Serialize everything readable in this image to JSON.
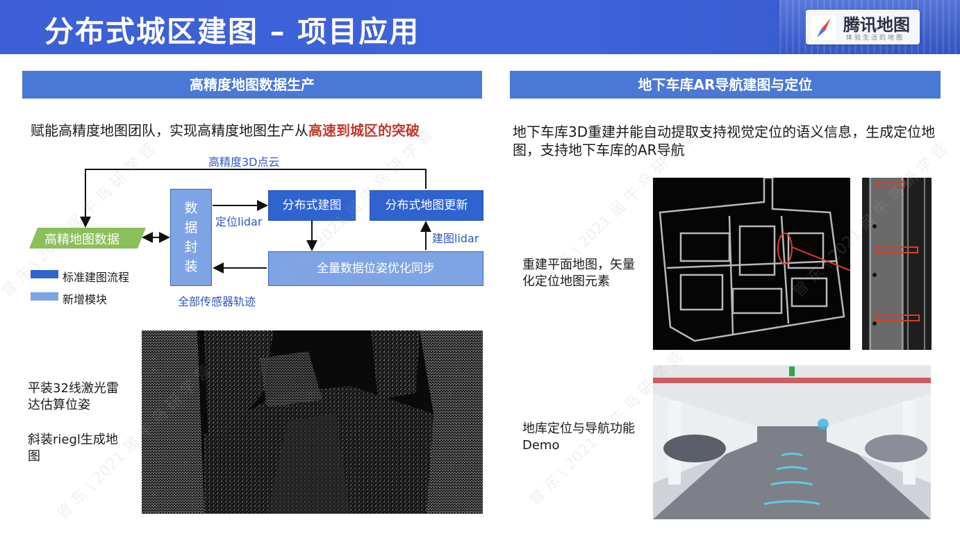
{
  "header": {
    "title": "分布式城区建图 – 项目应用",
    "logo_text": "腾讯地图",
    "logo_subtitle": "体验生活的地图"
  },
  "left": {
    "banner": "高精度地图数据生产",
    "intro_prefix": "赋能高精度地图团队，实现高精度地图生产从",
    "intro_highlight": "高速到城区的突破",
    "diagram": {
      "top_label": "高精度3D点云",
      "hd_map_data": "高精地图数据",
      "packaging_chars": [
        "数",
        "据",
        "封",
        "装"
      ],
      "positioning_lidar": "定位lidar",
      "distributed_mapping": "分布式建图",
      "distributed_update": "分布式地图更新",
      "mapping_lidar": "建图lidar",
      "full_sync": "全量数据位姿优化同步",
      "sensor_track": "全部传感器轨迹",
      "legend_standard": "标准建图流程",
      "legend_new": "新增模块"
    },
    "caption1": "平装32线激光雷达估算位姿",
    "caption2": "斜装riegl生成地图"
  },
  "right": {
    "banner": "地下车库AR导航建图与定位",
    "intro": "地下车库3D重建并能自动提取支持视觉定位的语义信息，生成定位地图，支持地下车库的AR导航",
    "caption1": "重建平面地图，矢量化定位地图元素",
    "caption2": "地库定位与导航功能Demo"
  },
  "watermark": "曾 东 \\ 2021 届 牛 鸟 研 学 营",
  "colors": {
    "header_blue": "#3e63da",
    "banner_blue": "#4a78d6",
    "highlight_red": "#c0392b",
    "box_dark": "#2f63d0",
    "box_light": "#7fa4e6",
    "hd_green": "#8bbf5a"
  }
}
